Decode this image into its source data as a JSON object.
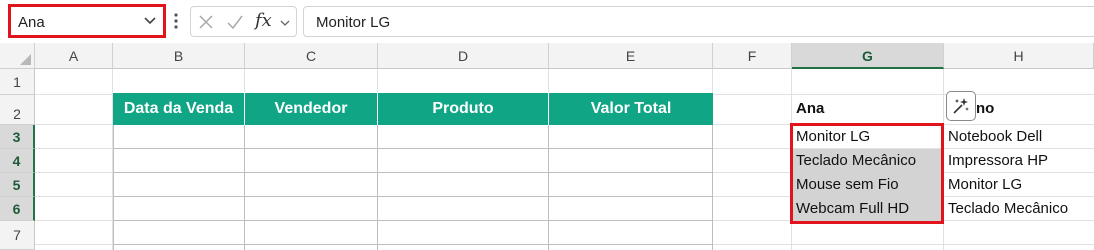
{
  "formula_bar": {
    "name_box_value": "Ana",
    "fx_label": "fx",
    "formula_value": "Monitor LG"
  },
  "columns": [
    "A",
    "B",
    "C",
    "D",
    "E",
    "F",
    "G",
    "H"
  ],
  "rows": [
    "1",
    "2",
    "3",
    "4",
    "5",
    "6",
    "7"
  ],
  "table": {
    "headers": [
      "Data da Venda",
      "Vendedor",
      "Produto",
      "Valor Total"
    ],
    "header_color": "#0fa585"
  },
  "list_g": {
    "header": "Ana",
    "items": [
      "Monitor LG",
      "Teclado Mecânico",
      "Mouse sem Fio",
      "Webcam Full HD"
    ]
  },
  "list_h": {
    "header_partial": "no",
    "items": [
      "Notebook Dell",
      "Impressora HP",
      "Monitor LG",
      "Teclado Mecânico"
    ]
  },
  "icons": {
    "name_box_dropdown": "chevron-down-icon",
    "more_options": "vertical-dots-icon",
    "cancel": "close-icon",
    "enter": "check-icon",
    "insert_function": "fx-icon",
    "quick_analysis": "sparkle-icon"
  },
  "highlight_color": "#e1141d"
}
